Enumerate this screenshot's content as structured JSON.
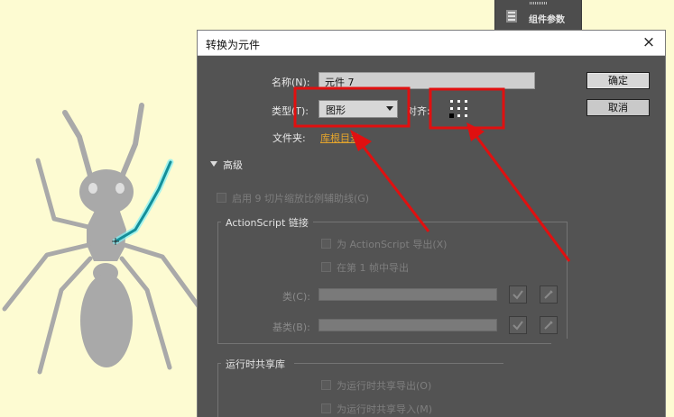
{
  "panel_tab": {
    "label": "组件参数",
    "icon": "component-params-icon"
  },
  "dialog": {
    "title": "转换为元件",
    "close_glyph": "×",
    "name_label": "名称(N):",
    "name_value": "元件 7",
    "type_label": "类型(T):",
    "type_value": "图形",
    "align_label": "对齐:",
    "folder_label": "文件夹:",
    "folder_value": "库根目录",
    "ok_label": "确定",
    "cancel_label": "取消",
    "advanced_label": "高级",
    "scale9_label": "启用 9 切片缩放比例辅助线(G)",
    "actionscript": {
      "group_label": "ActionScript 链接",
      "export_as_label": "为 ActionScript 导出(X)",
      "export_frame_label": "在第 1 帧中导出",
      "class_label": "类(C):",
      "base_class_label": "基类(B):"
    },
    "runtime": {
      "group_label": "运行时共享库",
      "export_runtime_label": "为运行时共享导出(O)",
      "import_runtime_label": "为运行时共享导入(M)"
    }
  },
  "colors": {
    "stage_background": "#fdfbd2",
    "dialog_background": "#535353",
    "highlight_red": "#e01010",
    "folder_link": "#e5a52c",
    "ant_gray": "#a9a9a9",
    "selected_stroke": "#37d6e6"
  }
}
